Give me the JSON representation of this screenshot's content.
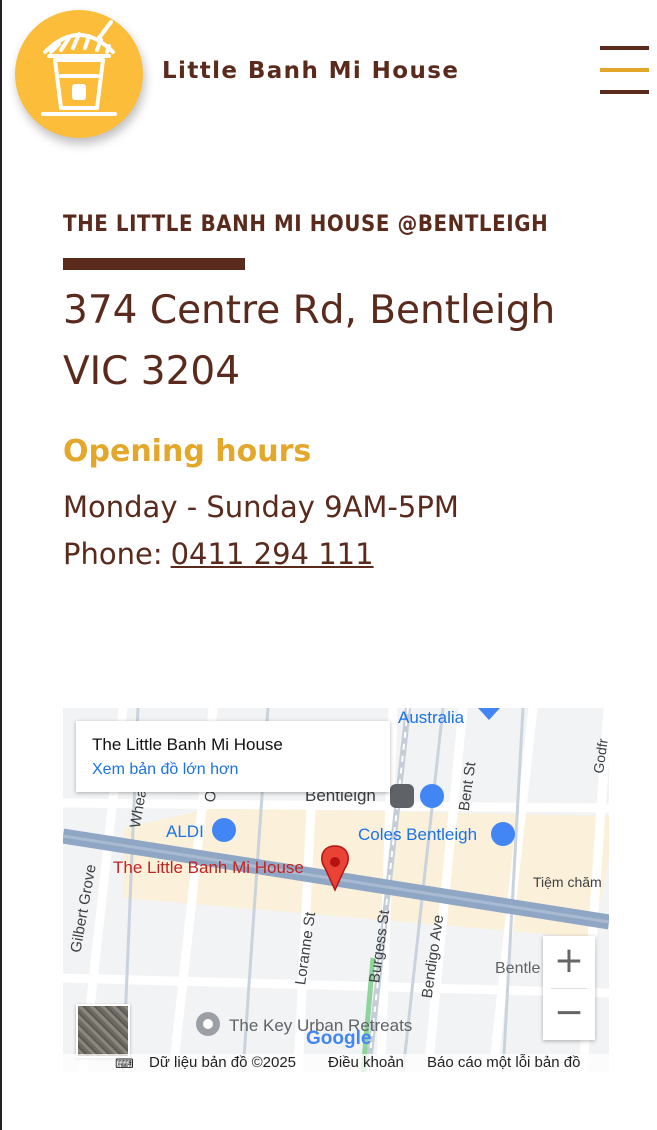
{
  "header": {
    "brand_name": "Little Banh Mi House",
    "logo_icon": "banh-mi-drink-cup-icon",
    "menu_icon": "hamburger-menu-icon"
  },
  "store": {
    "title": "THE LITTLE BANH MI HOUSE @BENTLEIGH",
    "address_line1": "374 Centre Rd, Bentleigh",
    "address_line2": "VIC 3204",
    "hours_heading": "Opening hours",
    "hours": "Monday - Sunday 9AM-5PM",
    "phone_label": "Phone:",
    "phone_number": "0411 294 111"
  },
  "map": {
    "card_title": "The Little Banh Mi House",
    "card_link": "Xem bản đồ lớn hơn",
    "labels": {
      "australia": "Australia",
      "bentleigh": "Bentleigh",
      "aldi": "ALDI",
      "coles": "Coles Bentleigh",
      "pin_label": "The Little Banh Mi House",
      "tiem_cham": "Tiệm chăm",
      "gilbert_grove": "Gilbert Grove",
      "wheatley": "Whea",
      "loranne": "Loranne St",
      "burgess": "Burgess St",
      "bendigo": "Bendigo Ave",
      "bent_st": "Bent St",
      "godfrey": "Godfr",
      "bentleigh_right": "Bentle",
      "key_urban": "The Key Urban Retreats",
      "o_road": "O"
    },
    "zoom_in": "+",
    "zoom_out": "−",
    "google": "Google",
    "footer": {
      "data": "Dữ liệu bản đồ ©2025",
      "terms": "Điều khoản",
      "report": "Báo cáo một lỗi bản đồ"
    },
    "colors": {
      "pin": "#ea4335",
      "poi_blue": "#1a73e8",
      "rail": "#8fa6c4"
    }
  },
  "colors": {
    "brand_brown": "#5a2a1c",
    "accent_gold": "#e3a82b",
    "logo_yellow": "#fbbd3a"
  }
}
